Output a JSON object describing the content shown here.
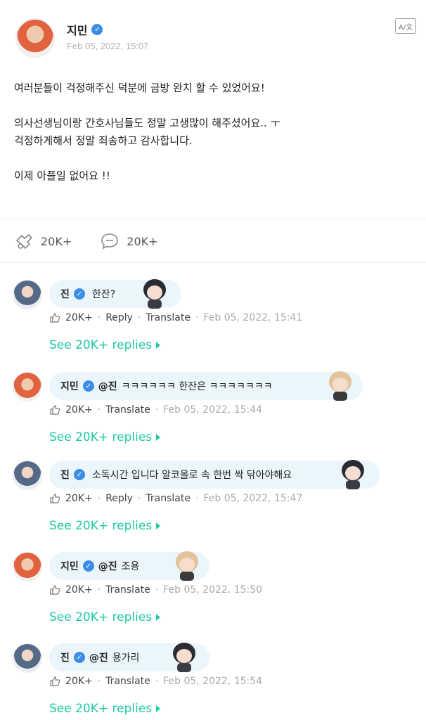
{
  "post": {
    "author": "지민",
    "date": "Feb 05, 2022, 15:07",
    "translate_icon": "translate-icon",
    "paragraphs": [
      "여러분들이 걱정해주신 덕분에 금방 완치 할 수 있었어요!",
      "의사선생님이랑 간호사님들도 정말 고생많이 해주셨어요.. ㅜ\n걱정하게해서 정말 죄송하고 감사합니다.",
      "이제 아플일 없어요 !!"
    ],
    "likes": "20K+",
    "comments_count": "20K+"
  },
  "comments": [
    {
      "author": "진",
      "avatar": "jin",
      "mention": "",
      "text": "한잔?",
      "likes": "20K+",
      "reply_label": "Reply",
      "translate_label": "Translate",
      "time": "Feb 05, 2022, 15:41",
      "replies": "See 20K+ replies"
    },
    {
      "author": "지민",
      "avatar": "jimin",
      "mention": "@진",
      "text": "ㅋㅋㅋㅋㅋㅋ 한잔은 ㅋㅋㅋㅋㅋㅋㅋ",
      "likes": "20K+",
      "reply_label": "",
      "translate_label": "Translate",
      "time": "Feb 05, 2022, 15:44",
      "replies": "See 20K+ replies"
    },
    {
      "author": "진",
      "avatar": "jin",
      "mention": "",
      "text": "소독시간 입니다 알코올로 속 한번 싹 닦아야해요",
      "likes": "20K+",
      "reply_label": "Reply",
      "translate_label": "Translate",
      "time": "Feb 05, 2022, 15:47",
      "replies": "See 20K+ replies"
    },
    {
      "author": "지민",
      "avatar": "jimin",
      "mention": "@진",
      "text": "조용",
      "likes": "20K+",
      "reply_label": "",
      "translate_label": "Translate",
      "time": "Feb 05, 2022, 15:50",
      "replies": "See 20K+ replies"
    },
    {
      "author": "진",
      "avatar": "jin",
      "mention": "@진",
      "text": "용가리",
      "likes": "20K+",
      "reply_label": "",
      "translate_label": "Translate",
      "time": "Feb 05, 2022, 15:54",
      "replies": "See 20K+ replies"
    }
  ],
  "colors": {
    "accent": "#1fc9a6",
    "bubble": "#ebf5fc",
    "verified": "#3d8de6"
  }
}
